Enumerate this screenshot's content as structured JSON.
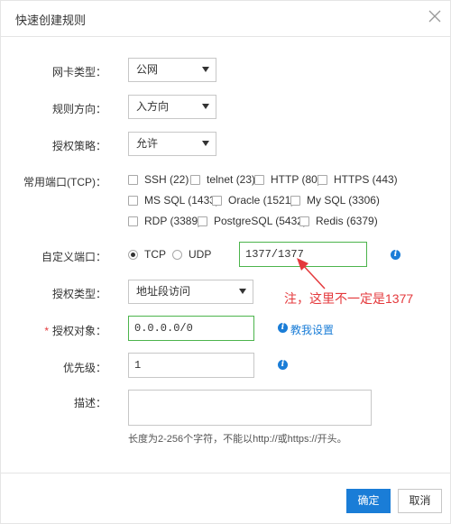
{
  "dialog": {
    "title": "快速创建规则"
  },
  "form": {
    "nic_type": {
      "label": "网卡类型：",
      "value": "公网"
    },
    "direction": {
      "label": "规则方向：",
      "value": "入方向"
    },
    "policy": {
      "label": "授权策略：",
      "value": "允许"
    },
    "common_ports": {
      "label": "常用端口(TCP)：",
      "options": [
        "SSH (22)",
        "telnet (23)",
        "HTTP (80)",
        "HTTPS (443)",
        "MS SQL (1433)",
        "Oracle (1521)",
        "My SQL (3306)",
        "RDP (3389)",
        "PostgreSQL (5432)",
        "Redis (6379)"
      ]
    },
    "custom_port": {
      "label": "自定义端口：",
      "tcp_label": "TCP",
      "udp_label": "UDP",
      "selected": "TCP",
      "value": "1377/1377"
    },
    "auth_type": {
      "label": "授权类型：",
      "value": "地址段访问"
    },
    "auth_object": {
      "label": "授权对象：",
      "required_mark": "*",
      "value": "0.0.0.0/0",
      "help_link": "教我设置"
    },
    "priority": {
      "label": "优先级：",
      "value": "1"
    },
    "description": {
      "label": "描述：",
      "value": "",
      "hint": "长度为2-256个字符，不能以http://或https://开头。"
    }
  },
  "annotation": {
    "text": "注，这里不一定是1377",
    "color": "#e4393c"
  },
  "buttons": {
    "confirm": "确定",
    "cancel": "取消"
  },
  "colors": {
    "primary": "#1a7dd7",
    "valid_border": "#4cb44c",
    "annotation": "#e4393c"
  }
}
